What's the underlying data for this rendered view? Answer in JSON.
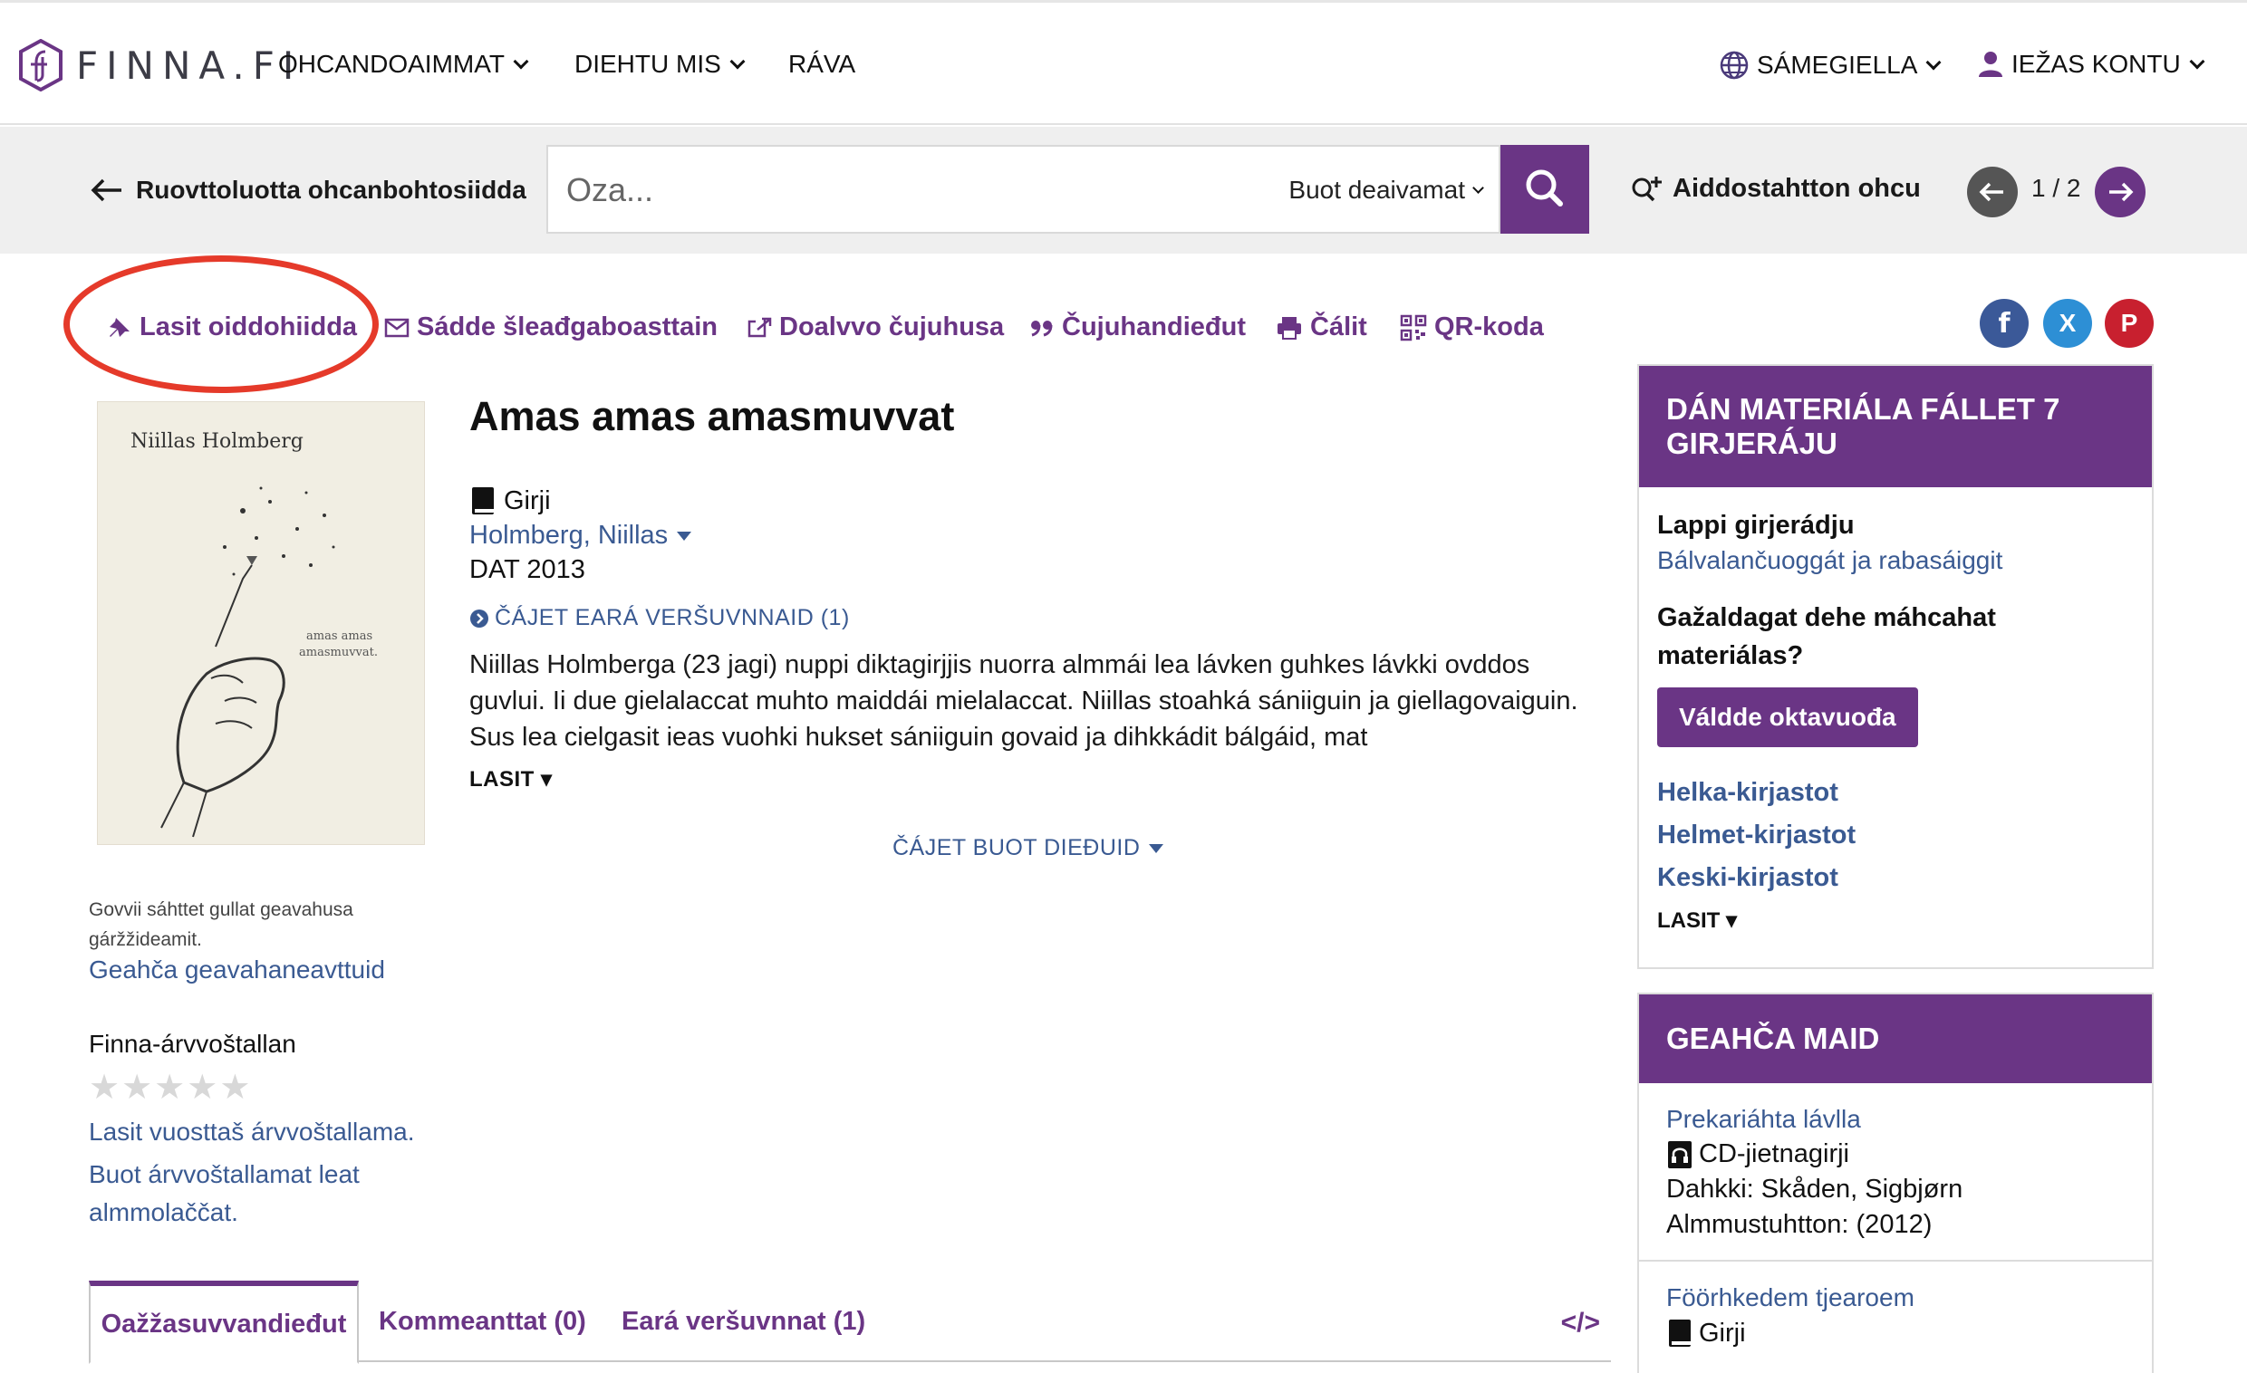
{
  "header": {
    "logo_text": "FINNA.FI",
    "nav": [
      "OHCANDOAIMMAT",
      "DIEHTU MIS",
      "RÁVA"
    ],
    "language": "SÁMEGIELLA",
    "account": "IEŽAS KONTU"
  },
  "search": {
    "back_label": "Ruovttoluotta ohcanbohtosiidda",
    "placeholder": "Oza...",
    "scope": "Buot deaivamat",
    "advanced_label": "Aiddostahtton ohcu",
    "pager": "1 / 2"
  },
  "actions": {
    "favorite": "Lasit oiddohiidda",
    "email": "Sádde šleađgaboasttain",
    "export": "Doalvvo čujuhusa",
    "cite": "Čujuhandieđut",
    "print": "Čálit",
    "qr": "QR-koda"
  },
  "social": {
    "facebook": "f",
    "x": "X",
    "pinterest": "P"
  },
  "cover": {
    "author_on_cover": "Niillas Holmberg",
    "title_on_cover": "amas amas amasmuvvat"
  },
  "left": {
    "cover_note": "Govvii sáhttet gullat geavahusa gáržžideamit.",
    "license_link": "Geahča geavahaneavttuid",
    "rating_title": "Finna-árvvoštallan",
    "rating_value": 0,
    "rating_add": "Lasit vuosttaš árvvoštallama.",
    "rating_public": "Buot árvvoštallamat leat almmolaččat."
  },
  "record": {
    "title": "Amas amas amasmuvvat",
    "format": "Girji",
    "author": "Holmberg, Niillas",
    "year": "DAT 2013",
    "other_versions": "ČÁJET EARÁ VERŠUVNNAID (1)",
    "summary": "Niillas Holmberga (23 jagi) nuppi diktagirjjis nuorra almmái lea lávken guhkes lávkki ovddos guvlui. Ii due gielalaccat muhto maiddái mielalaccat. Niillas stoahká sániiguin ja giellagovaiguin. Sus lea cielgasit ieas vuohki hukset sániiguin govaid ja dihkkádit bálgáid, mat",
    "more": "LASIT ▾",
    "all_details": "ČÁJET BUOT DIEĐUID"
  },
  "tabs": {
    "t1": "Oažžasuvvandieđut",
    "t2": "Kommeanttat (0)",
    "t3": "Eará veršuvnnat (1)",
    "embed": "</>"
  },
  "sidebar": {
    "panel1_title": "DÁN MATERIÁLA FÁLLET 7 GIRJERÁJU",
    "add_library": "Lappi girjerádju",
    "services_link": "Bálvalančuoggát ja rabasáiggit",
    "feedback_question": "Gažaldagat dehe máhcahat materiálas?",
    "feedback_button": "Váldde oktavuođa",
    "libraries": [
      "Helka-kirjastot",
      "Helmet-kirjastot",
      "Keski-kirjastot"
    ],
    "more": "LASIT ▾",
    "panel2_title": "GEAHČA MAID",
    "rec1": {
      "title": "Prekariáhta lávlla",
      "format": "CD-jietnagirji",
      "author": "Dahkki: Skåden, Sigbjørn",
      "published": "Almmustuhtton: (2012)"
    },
    "rec2": {
      "title": "Föörhkedem tjearoem",
      "format": "Girji"
    }
  },
  "colors": {
    "brand": "#6a3585",
    "link": "#3a5a92",
    "highlight": "#e53a2a"
  }
}
